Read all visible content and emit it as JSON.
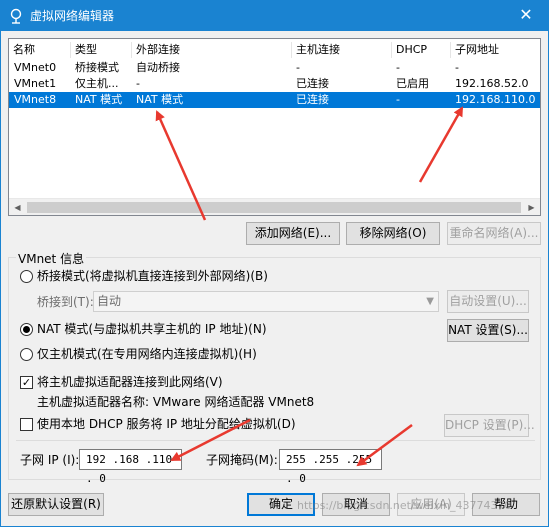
{
  "window": {
    "title": "虚拟网络编辑器",
    "close_icon": "close-icon"
  },
  "table": {
    "headers": [
      "名称",
      "类型",
      "外部连接",
      "主机连接",
      "DHCP",
      "子网地址"
    ],
    "rows": [
      [
        "VMnet0",
        "桥接模式",
        "自动桥接",
        "-",
        "-",
        "-"
      ],
      [
        "VMnet1",
        "仅主机...",
        "-",
        "已连接",
        "已启用",
        "192.168.52.0"
      ],
      [
        "VMnet8",
        "NAT 模式",
        "NAT 模式",
        "已连接",
        "-",
        "192.168.110.0"
      ]
    ],
    "selected_row": 2
  },
  "buttons": {
    "add_network": "添加网络(E)...",
    "remove_network": "移除网络(O)",
    "rename_network": "重命名网络(A)...",
    "auto_settings": "自动设置(U)...",
    "nat_settings": "NAT 设置(S)...",
    "dhcp_settings": "DHCP 设置(P)...",
    "restore_defaults": "还原默认设置(R)",
    "ok": "确定",
    "cancel": "取消",
    "apply": "应用(A)",
    "help": "帮助"
  },
  "vmnet_info": {
    "group_label": "VMnet 信息",
    "bridged_label": "桥接模式(将虚拟机直接连接到外部网络)(B)",
    "bridged_to_label": "桥接到(T):",
    "bridged_to_value": "自动",
    "nat_label": "NAT 模式(与虚拟机共享主机的 IP 地址)(N)",
    "hostonly_label": "仅主机模式(在专用网络内连接虚拟机)(H)",
    "selected_mode": "nat",
    "connect_adapter_label": "将主机虚拟适配器连接到此网络(V)",
    "connect_adapter_checked": true,
    "adapter_name_label": "主机虚拟适配器名称: VMware 网络适配器 VMnet8",
    "dhcp_label": "使用本地 DHCP 服务将 IP 地址分配给虚拟机(D)",
    "dhcp_checked": false,
    "subnet_ip_label": "子网 IP (I):",
    "subnet_ip_value": "192 .168 .110 . 0",
    "subnet_mask_label": "子网掩码(M):",
    "subnet_mask_value": "255 .255 .255 . 0"
  },
  "watermark": "https://blog.csdn.net/weixin_43774370",
  "colors": {
    "titlebar": "#1a83d1",
    "selection": "#0078d7",
    "annotation_arrow": "#e8392f"
  }
}
